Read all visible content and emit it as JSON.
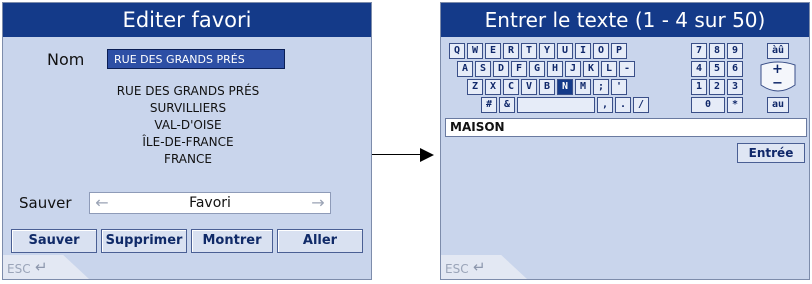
{
  "left": {
    "title": "Editer favori",
    "name_label": "Nom",
    "name_value": "RUE DES GRANDS PRÉS",
    "address": [
      "RUE DES GRANDS PRÉS",
      "SURVILLIERS",
      "VAL-D'OISE",
      "ÎLE-DE-FRANCE",
      "FRANCE"
    ],
    "save_label": "Sauver",
    "save_option": "Favori",
    "buttons": [
      "Sauver",
      "Supprimer",
      "Montrer",
      "Aller"
    ],
    "esc": "ESC"
  },
  "right": {
    "title": "Entrer le texte (1 - 4 sur 50)",
    "keyboard_rows": [
      [
        "Q",
        "W",
        "E",
        "R",
        "T",
        "Y",
        "U",
        "I",
        "O",
        "P"
      ],
      [
        "A",
        "S",
        "D",
        "F",
        "G",
        "H",
        "J",
        "K",
        "L",
        "-"
      ],
      [
        "Z",
        "X",
        "C",
        "V",
        "B",
        "N",
        "M",
        ";",
        "'"
      ],
      [
        "#",
        "&",
        "",
        ",",
        ".",
        "/"
      ]
    ],
    "numpad": [
      [
        "7",
        "8",
        "9"
      ],
      [
        "4",
        "5",
        "6"
      ],
      [
        "1",
        "2",
        "3"
      ],
      [
        "0",
        "*"
      ]
    ],
    "selected_key": "N",
    "case_top": "àû",
    "case_bottom": "au",
    "zoom_plus": "+",
    "zoom_minus": "−",
    "text_value": "MAISON",
    "enter_label": "Entrée",
    "esc": "ESC"
  },
  "colors": {
    "title_bar": "#143a89",
    "background": "#c9d5ec",
    "accent": "#2d4fa5"
  }
}
